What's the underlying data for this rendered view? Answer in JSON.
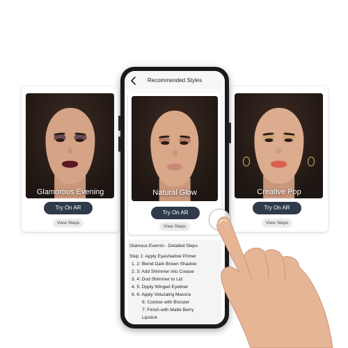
{
  "screen": {
    "title": "Recommended Styles"
  },
  "looks": [
    {
      "title": "Glamorous Evening",
      "ar_label": "Try On AR",
      "steps_label": "View Steps",
      "lip_color": "#5a1826",
      "shadow_color": "#4a2d4a"
    },
    {
      "title": "Natural Glow",
      "ar_label": "Try On AR",
      "steps_label": "View Steps",
      "lip_color": "#c98a7a",
      "shadow_color": "#a9725a"
    },
    {
      "title": "Creative Pop",
      "ar_label": "Try On AR",
      "steps_label": "View Steps",
      "lip_color": "#d9604f",
      "shadow_color": "#c8a06a"
    }
  ],
  "steps_panel": {
    "title": "Glamous Evernin - Detailed Steps",
    "lines": [
      "Step 1: Apply Eyeshadow Primer",
      "1.   2:  Blend Dark Brown Shadow",
      "2.   3:  Add Shimmer into Crease",
      "3.   4:  Dod Shimmer to Lid",
      "4.   5:  Dpply Winged Eyeliner",
      "6.   6:  Apply Voluzaing Masora",
      "6:  Contow with Bronzer",
      "7:  Finish with Matte Berry",
      "Lipstick"
    ]
  },
  "colors": {
    "button_dark": "#2f3a4a",
    "skin": "#d9a888",
    "phone_body": "#1a1a1c"
  }
}
